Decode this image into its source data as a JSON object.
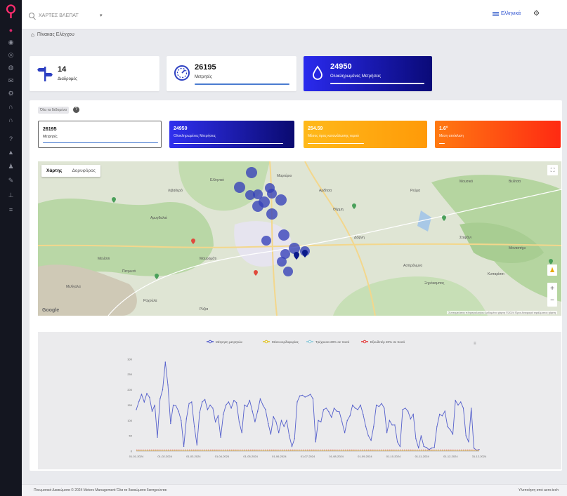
{
  "topbar": {
    "search_placeholder": "ΧΑΡΤΕΣ ΒΛΕΠΑΤ",
    "language": "Ελληνικά"
  },
  "breadcrumb": {
    "label": "Πίνακας Ελέγχου"
  },
  "stats": [
    {
      "value": "14",
      "label": "Διαδρομές"
    },
    {
      "value": "26195",
      "label": "Μετρητές"
    },
    {
      "value": "24950",
      "label": "Ολοκληρωμένες Μετρήσεις"
    }
  ],
  "filter": {
    "selected": "Όλα τα δεδομένα"
  },
  "metrics": [
    {
      "value": "26195",
      "label": "Μετρητές",
      "progress": 1.0
    },
    {
      "value": "24950",
      "label": "Ολοκληρωμένες Μετρήσεις",
      "progress": 0.95
    },
    {
      "value": "254.59",
      "label": "Μέσος όρος κατανάλωσης νερού",
      "progress": 0.5
    },
    {
      "value": "1.6°",
      "label": "Μέση απόκλιση",
      "progress": 0.05
    }
  ],
  "map": {
    "tab_map": "Χάρτης",
    "tab_satellite": "Δορυφόρος",
    "google_label": "Google",
    "attribution": "Συντομεύσεις πληκτρολογίου  Δεδομένα χάρτη ©2024  Όροι  Αναφορά σφάλματος χάρτη",
    "place_labels": [
      "Ελληνικό",
      "Μαρτύριο",
      "Λιβαδερό",
      "Αρδίτσα",
      "Ρεύμα",
      "Μουσικό",
      "Βελίτσα",
      "Αμυγδαλιά",
      "Θέρμη",
      "Μελίσσι",
      "Πετρωτό",
      "Μαυρομάτι",
      "Ασπρόλιμνο",
      "Ξηρόκαμπος",
      "Στεφάνι",
      "Μοναστήρι",
      "Κυπαρίσσι",
      "Ραχούλα",
      "Ρύζια",
      "Δάφνη",
      "Μελίγαλα"
    ]
  },
  "chart_data": {
    "type": "line",
    "title": "",
    "legend": [
      "Μέτρηση μετρητών",
      "Μέσο κερδοφορίας",
      "Τρέχουσα 20% σε ποσό",
      "Εξουδετέρ 20% σε ποσό"
    ],
    "legend_colors": [
      "#4a55c8",
      "#e0c020",
      "#8ac8d8",
      "#e03a3a"
    ],
    "y_ticks": [
      "0",
      "50",
      "100",
      "150",
      "200",
      "250",
      "300"
    ],
    "x_ticks": [
      "01-01-2024",
      "01-02-2024",
      "01-03-2024",
      "01-04-2024",
      "01-05-2024",
      "01-06-2024",
      "01-07-2024",
      "01-08-2024",
      "01-09-2024",
      "01-10-2024",
      "01-11-2024",
      "01-12-2024",
      "31-12-2024"
    ],
    "ylim": [
      0,
      320
    ],
    "series": [
      {
        "name": "Μέτρηση μετρητών",
        "values": [
          135,
          162,
          185,
          160,
          188,
          175,
          130,
          150,
          45,
          170,
          200,
          290,
          215,
          90,
          150,
          148,
          130,
          100,
          15,
          105,
          155,
          160,
          80,
          20,
          125,
          160,
          168,
          135,
          150,
          140,
          95,
          115,
          45,
          120,
          150,
          160,
          140,
          165,
          158,
          95,
          60,
          150,
          145,
          165,
          130,
          95,
          130,
          170,
          150,
          135,
          90,
          55,
          112,
          95,
          60,
          100,
          80,
          100,
          50,
          15,
          40,
          160,
          180,
          182,
          176,
          180,
          185,
          170,
          30,
          100,
          95,
          135,
          140,
          128,
          110,
          140,
          130,
          128,
          95,
          60,
          100,
          115,
          150,
          140,
          135,
          150,
          120,
          80,
          50,
          35,
          80,
          150,
          145,
          155,
          140,
          60,
          100,
          85,
          85,
          30,
          15,
          135,
          140,
          130,
          105,
          120,
          40,
          10,
          50,
          15,
          12,
          5,
          10,
          12,
          80,
          120,
          115,
          130,
          80,
          70,
          55,
          165,
          150,
          160,
          140,
          50,
          30,
          140,
          10,
          3,
          5
        ]
      },
      {
        "name": "Μέσο κερδοφορίας",
        "values": [
          2
        ]
      },
      {
        "name": "Εξουδετέρ 20% σε ποσό",
        "values": [
          4
        ]
      }
    ]
  },
  "footer": {
    "left": "Πνευματικά Δικαιώματα © 2024 Meters Management Όλα τα δικαιώματα διατηρούνται",
    "right": "Υλοποίηση από aero.tech"
  }
}
